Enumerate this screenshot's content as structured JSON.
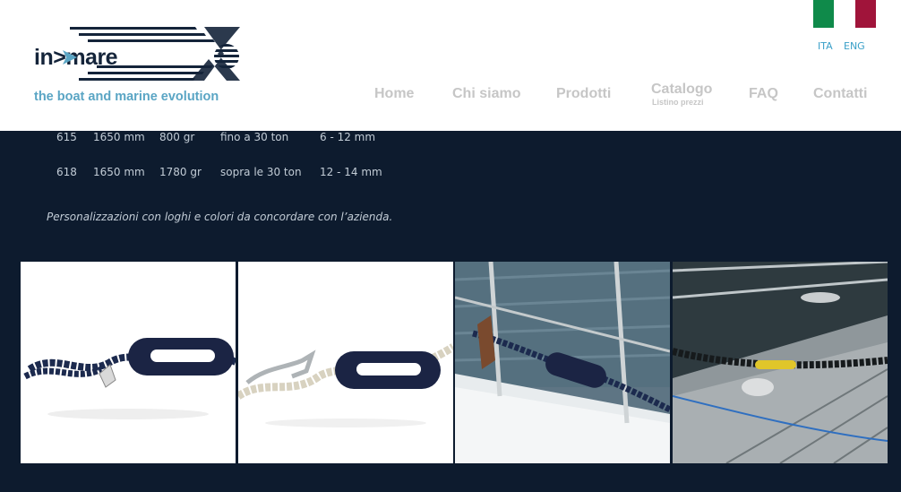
{
  "header": {
    "logo": {
      "wordmark": "in>mare",
      "tagline": "the boat and marine evolution"
    },
    "flag_colors": [
      "#0f8a4a",
      "#ffffff",
      "#a0143a"
    ],
    "languages": [
      "ITA",
      "ENG"
    ],
    "nav": [
      {
        "label": "Home"
      },
      {
        "label": "Chi siamo"
      },
      {
        "label": "Prodotti"
      },
      {
        "label": "Catalogo",
        "sub": "Listino prezzi"
      },
      {
        "label": "FAQ"
      },
      {
        "label": "Contatti"
      }
    ]
  },
  "specs": {
    "rows": [
      {
        "code": "615",
        "length": "1650 mm",
        "weight": "800 gr",
        "capacity": "fino a 30 ton",
        "diameter": "6 - 12 mm"
      },
      {
        "code": "618",
        "length": "1650 mm",
        "weight": "1780 gr",
        "capacity": "sopra le 30 ton",
        "diameter": "12 - 14 mm"
      }
    ],
    "note": "Personalizzazioni con loghi e colori da concordare con l’azienda."
  },
  "gallery": [
    {
      "name": "navy-snubber-on-white"
    },
    {
      "name": "white-rope-snubber-with-hook"
    },
    {
      "name": "snubber-on-sailboat-bow"
    },
    {
      "name": "snubber-on-deck-cleat"
    }
  ],
  "colors": {
    "background": "#0d1b2e",
    "nav_text": "#c6c6c6",
    "lang_link": "#3aa0c8",
    "brand_navy": "#14243a",
    "brand_blue": "#5aa5c4"
  }
}
